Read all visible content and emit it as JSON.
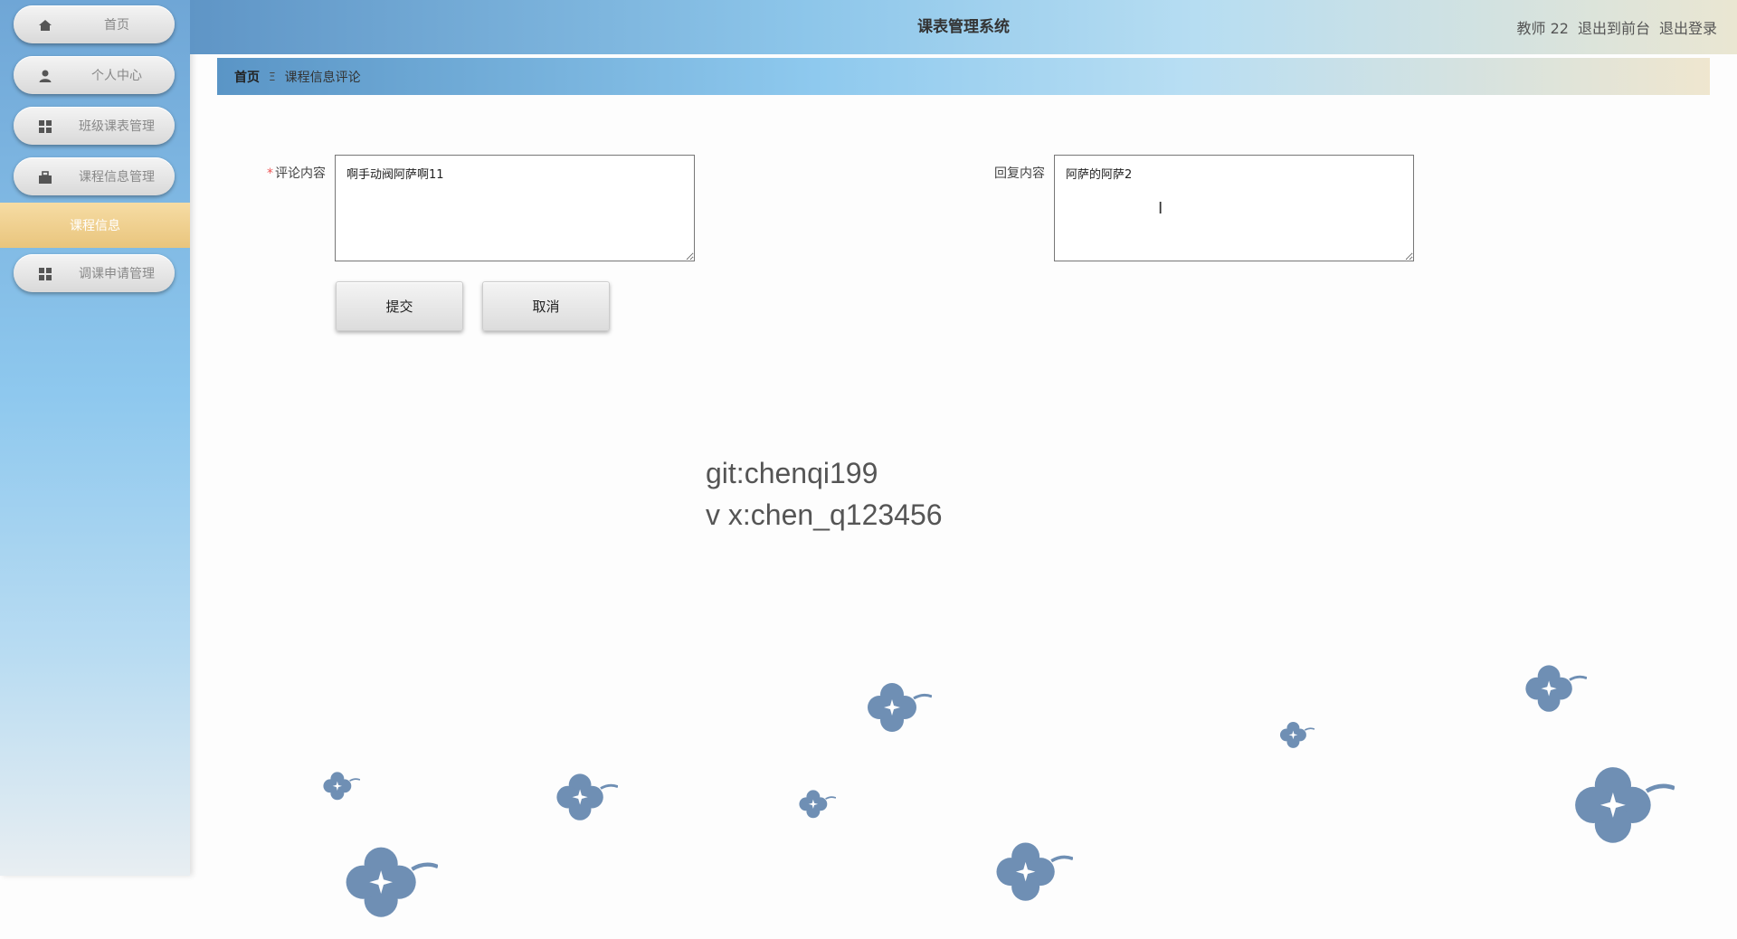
{
  "sidebar": {
    "items": [
      {
        "label": "首页",
        "icon": "home-icon"
      },
      {
        "label": "个人中心",
        "icon": "user-icon"
      },
      {
        "label": "班级课表管理",
        "icon": "grid-icon"
      },
      {
        "label": "课程信息管理",
        "icon": "briefcase-icon"
      },
      {
        "label": "调课申请管理",
        "icon": "grid-icon"
      }
    ],
    "active_sub": "课程信息"
  },
  "header": {
    "title": "课表管理系统",
    "user": "教师 22",
    "to_front": "退出到前台",
    "logout": "退出登录"
  },
  "breadcrumb": {
    "home": "首页",
    "separator": "Ξ",
    "current": "课程信息评论"
  },
  "form": {
    "comment_label": "评论内容",
    "comment_required": "*",
    "comment_value": "啊手动阀阿萨啊11",
    "reply_label": "回复内容",
    "reply_value": "阿萨的阿萨2",
    "submit": "提交",
    "cancel": "取消"
  },
  "watermark": {
    "line1": "git:chenqi199",
    "line2": "v x:chen_q123456"
  },
  "colors": {
    "accent_sidebar": "#8ec8ee",
    "active_item": "#e9c57d",
    "flower": "#6f8fb4"
  }
}
